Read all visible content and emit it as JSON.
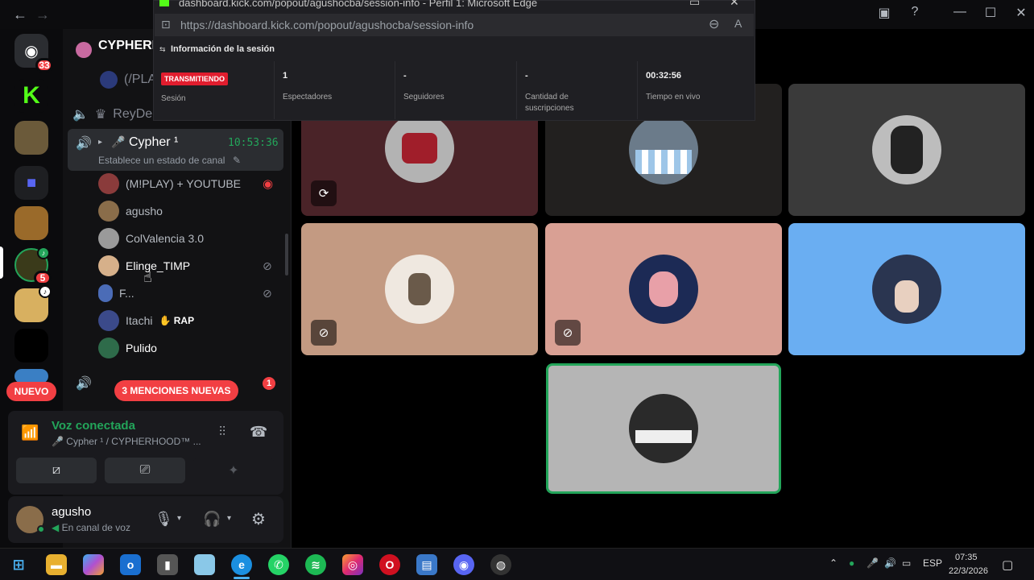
{
  "browser_popout": {
    "title": "dashboard.kick.com/popout/agushocba/session-info - Perfil 1: Microsoft Edge",
    "url": "https://dashboard.kick.com/popout/agushocba/session-info",
    "section_title": "Información de la sesión",
    "stats": [
      {
        "value": "TRANSMITIENDO",
        "label": "Sesión"
      },
      {
        "value": "1",
        "label": "Espectadores"
      },
      {
        "value": "-",
        "label": "Seguidores"
      },
      {
        "value": "-",
        "label": "Cantidad de suscripciones"
      },
      {
        "value": "00:32:56",
        "label": "Tiempo en vivo"
      }
    ]
  },
  "rail": {
    "discord_badge": "33",
    "server_badge": "5",
    "new_label": "NUEVO",
    "kick_letter": "K"
  },
  "sidebar": {
    "server_name": "CYPHERHOOD",
    "channels_above": [
      {
        "name": "(/PLA"
      },
      {
        "name": "ReyDe"
      }
    ],
    "active_channel": {
      "name": "Cypher ¹",
      "time": "10:53:36",
      "status": "Establece un estado de canal"
    },
    "members": [
      {
        "name": "(M!PLAY) + YOUTUBE",
        "color": "#8a3b3b"
      },
      {
        "name": "agusho",
        "color": "#8a6d4a"
      },
      {
        "name": "ColValencia 3.0",
        "color": "#9a9a9a"
      },
      {
        "name": "Elinge_TIMP",
        "color": "#d6b08a"
      },
      {
        "name": "F...",
        "color": "#4b6cb7"
      },
      {
        "name": "Itachi",
        "tag": "RAP",
        "color": "#3b4a8a"
      },
      {
        "name": "Pulido",
        "color": "#2e6b4a"
      }
    ],
    "next_channel_badge": "1",
    "mentions_label": "3 MENCIONES NUEVAS"
  },
  "voice": {
    "status": "Voz conectada",
    "channel": "Cypher ¹ / CYPHERHOOD™ ..."
  },
  "user": {
    "name": "agusho",
    "status": "En canal de voz"
  },
  "tiles": [
    {
      "name": "tile-1",
      "bg": "#4a2328",
      "ring": "#b3b3b3",
      "icon": "screen-share-icon"
    },
    {
      "name": "tile-2",
      "bg": "#22201f",
      "ring": "#6b7b8a",
      "icon": ""
    },
    {
      "name": "tile-3",
      "bg": "#3a3a3a",
      "ring": "#bdbdbd",
      "icon": ""
    },
    {
      "name": "tile-4",
      "bg": "#c39a82",
      "ring": "#efe8e0",
      "icon": "mic-muted-icon"
    },
    {
      "name": "tile-5",
      "bg": "#d9a094",
      "ring": "#1c2a55",
      "icon": "mic-muted-icon"
    },
    {
      "name": "tile-6",
      "bg": "#6aaef2",
      "ring": "#2a3550",
      "icon": ""
    },
    {
      "name": "tile-7",
      "bg": "#b5b5b5",
      "ring": "#2a2a2a",
      "icon": ""
    }
  ],
  "taskbar": {
    "language": "ESP",
    "time": "07:35",
    "date": "22/3/2026"
  }
}
